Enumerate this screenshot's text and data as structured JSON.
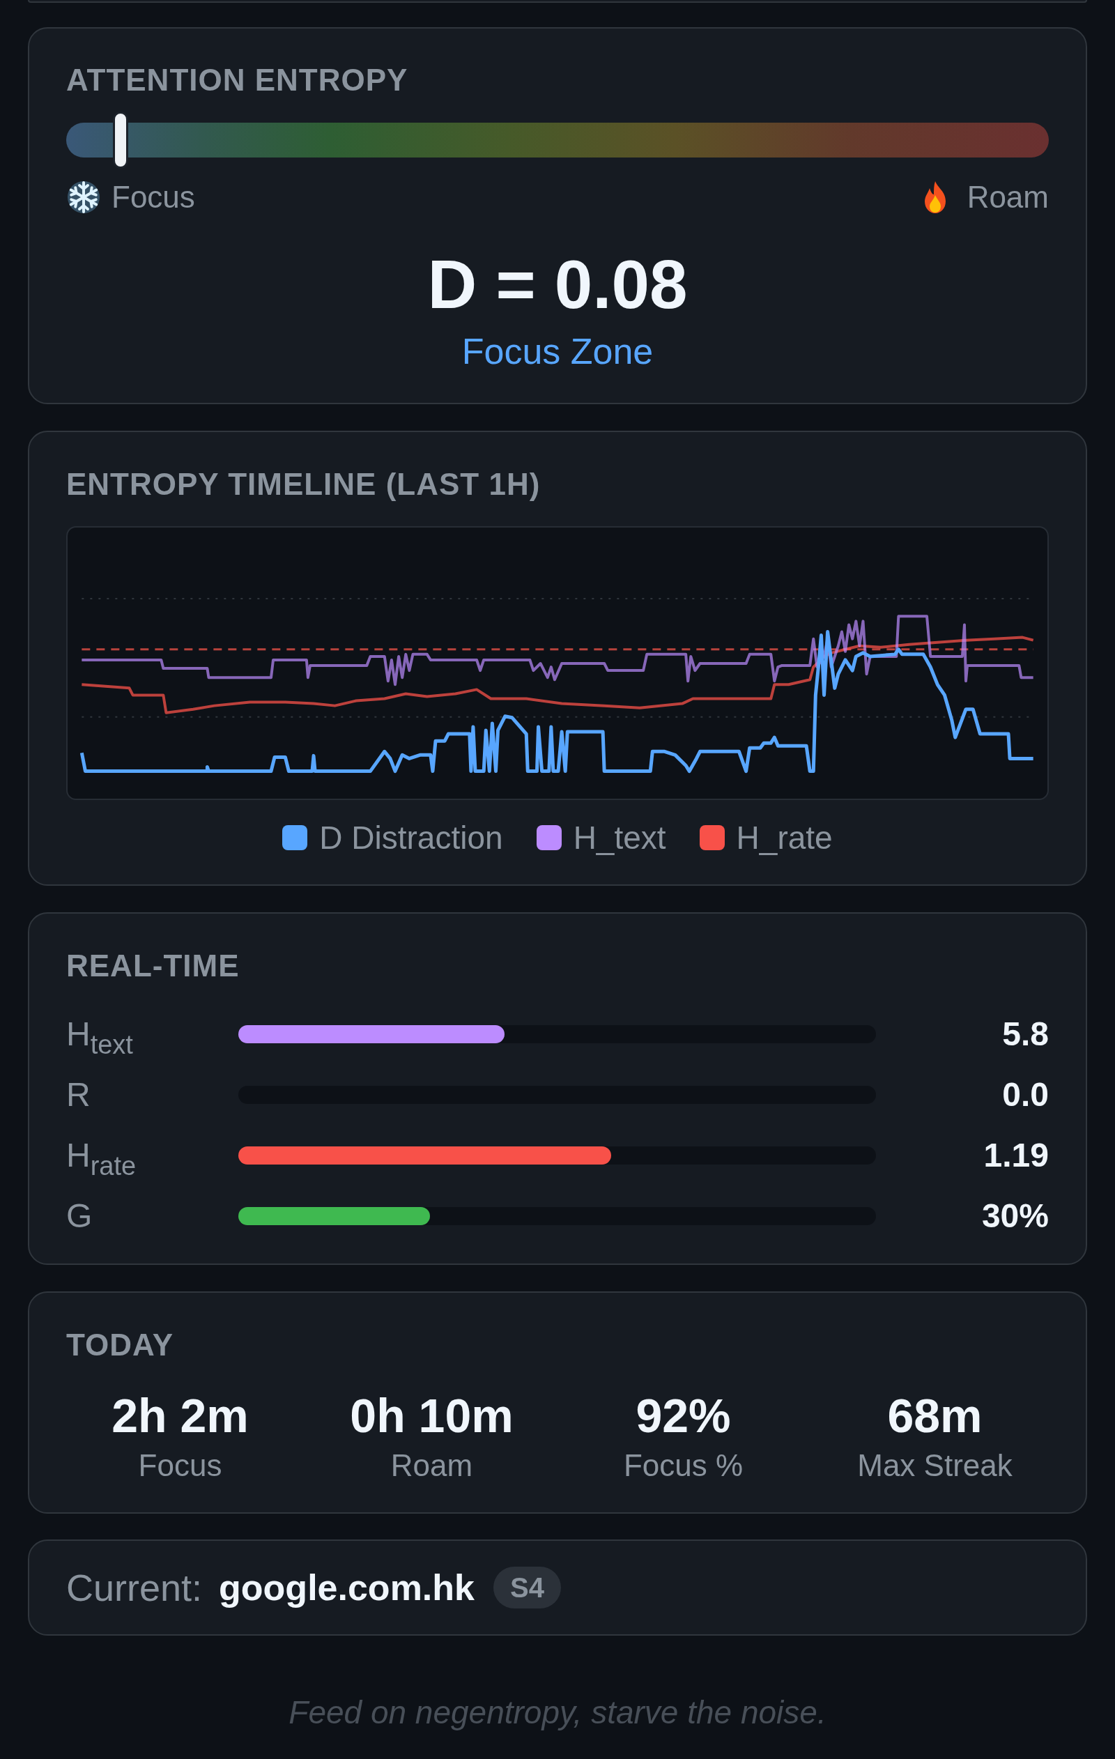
{
  "attention": {
    "title": "ATTENTION ENTROPY",
    "scale": {
      "level": 0.055,
      "left_label": "Focus",
      "right_label": "Roam"
    },
    "value": "D = 0.08",
    "zone": "Focus Zone"
  },
  "timeline": {
    "title": "ENTROPY TIMELINE (LAST 1H)",
    "legend": [
      {
        "label": "D Distraction",
        "color": "#58a6ff"
      },
      {
        "label": "H_text",
        "color": "#bc8cff"
      },
      {
        "label": "H_rate",
        "color": "#f85149"
      }
    ]
  },
  "realtime": {
    "title": "REAL-TIME",
    "rows": [
      {
        "label": "H$_{text}$",
        "level": 0.418,
        "color": "#bc8cff",
        "value": "5.8"
      },
      {
        "label": "R",
        "value": "0.0"
      },
      {
        "label": "H$_{rate}$",
        "level": 0.585,
        "color": "#f85149",
        "value": "1.19"
      },
      {
        "label": "G",
        "level": 0.3,
        "color": "#3fb950",
        "value": "30%"
      }
    ]
  },
  "today": {
    "title": "TODAY",
    "stats": [
      {
        "value": "2h 2m",
        "label": "Focus"
      },
      {
        "value": "0h 10m",
        "label": "Roam"
      },
      {
        "value": "92%",
        "label": "Focus %"
      },
      {
        "value": "68m",
        "label": "Max Streak"
      }
    ]
  },
  "current": {
    "label": "Current:",
    "site": "google.com.hk",
    "badge": "S4"
  },
  "footer": "Feed on negentropy, starve the noise."
}
